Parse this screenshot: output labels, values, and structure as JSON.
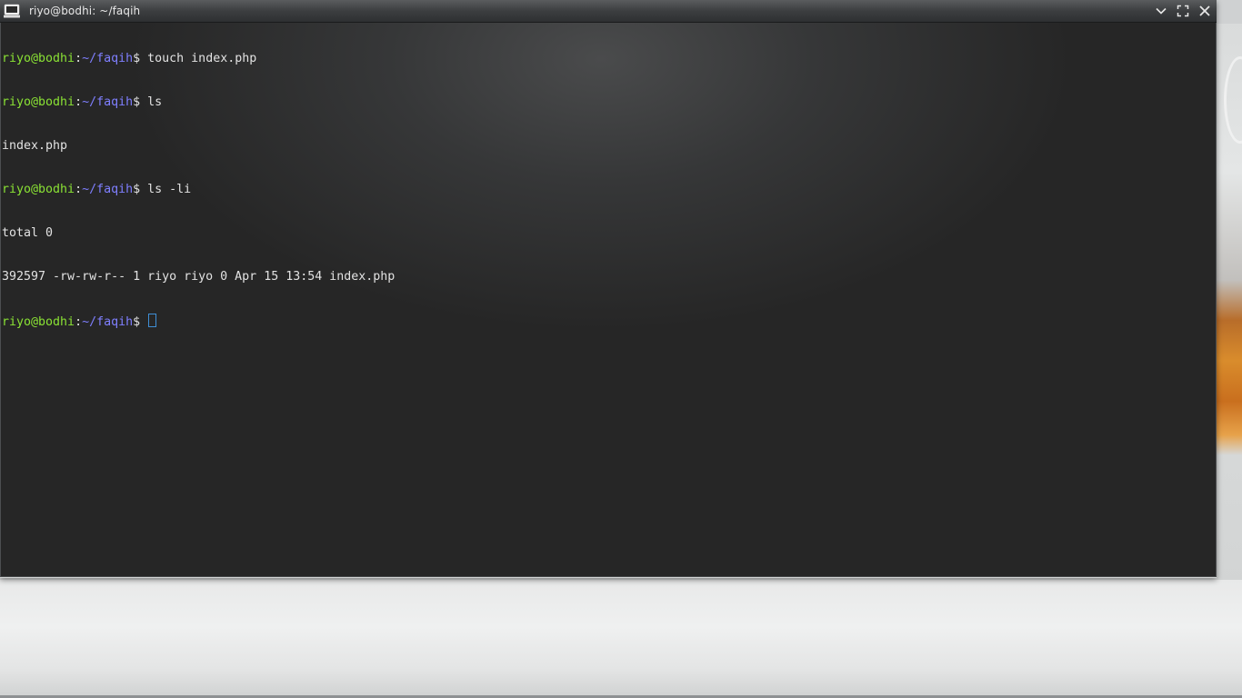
{
  "window": {
    "title": "riyo@bodhi: ~/faqih"
  },
  "icons": {
    "app": "terminal-icon",
    "minimize": "chevron-down-icon",
    "maximize": "maximize-icon",
    "close": "close-icon"
  },
  "colors": {
    "prompt_user": "#8ae234",
    "prompt_path": "#7f7fff",
    "text": "#e2e2e2",
    "cursor": "#3f8fd6"
  },
  "terminal": {
    "line1": {
      "user": "riyo@bodhi",
      "sep": ":",
      "path": "~/faqih",
      "sym": "$",
      "cmd": " touch index.php"
    },
    "line2": {
      "user": "riyo@bodhi",
      "sep": ":",
      "path": "~/faqih",
      "sym": "$",
      "cmd": " ls"
    },
    "line3": {
      "text": "index.php"
    },
    "line4": {
      "user": "riyo@bodhi",
      "sep": ":",
      "path": "~/faqih",
      "sym": "$",
      "cmd": " ls -li"
    },
    "line5": {
      "text": "total 0"
    },
    "line6": {
      "text": "392597 -rw-rw-r-- 1 riyo riyo 0 Apr 15 13:54 index.php"
    },
    "line7": {
      "user": "riyo@bodhi",
      "sep": ":",
      "path": "~/faqih",
      "sym": "$",
      "cmd": " "
    }
  }
}
